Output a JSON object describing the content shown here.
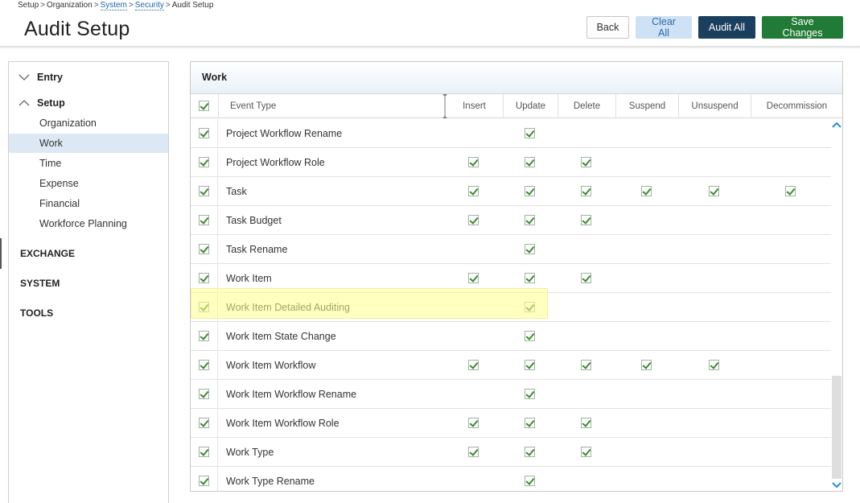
{
  "breadcrumb": {
    "items": [
      "Setup",
      "Organization",
      "System",
      "Security",
      "Audit Setup"
    ]
  },
  "page": {
    "title": "Audit Setup"
  },
  "toolbar": {
    "back_label": "Back",
    "clear_all_label": "Clear All",
    "audit_all_label": "Audit All",
    "save_label": "Save Changes"
  },
  "sidebar": {
    "groups": [
      {
        "label": "Entry",
        "expanded": false
      },
      {
        "label": "Setup",
        "expanded": true
      }
    ],
    "items": [
      "Organization",
      "Work",
      "Time",
      "Expense",
      "Financial",
      "Workforce Planning"
    ],
    "active_item": "Work",
    "sections": [
      "EXCHANGE",
      "SYSTEM",
      "TOOLS"
    ]
  },
  "panel": {
    "title": "Work",
    "columns": [
      "Event Type",
      "Insert",
      "Update",
      "Delete",
      "Suspend",
      "Unsuspend",
      "Decommission"
    ],
    "rows": [
      {
        "name": "Project Workflow Rename",
        "checks": [
          false,
          true,
          false,
          false,
          false,
          false
        ]
      },
      {
        "name": "Project Workflow Role",
        "checks": [
          true,
          true,
          true,
          false,
          false,
          false
        ]
      },
      {
        "name": "Task",
        "checks": [
          true,
          true,
          true,
          true,
          true,
          true
        ]
      },
      {
        "name": "Task Budget",
        "checks": [
          true,
          true,
          true,
          false,
          false,
          false
        ]
      },
      {
        "name": "Task Rename",
        "checks": [
          false,
          true,
          false,
          false,
          false,
          false
        ]
      },
      {
        "name": "Work Item",
        "checks": [
          true,
          true,
          true,
          false,
          false,
          false
        ]
      },
      {
        "name": "Work Item Detailed Auditing",
        "checks": [
          false,
          true,
          false,
          false,
          false,
          false
        ]
      },
      {
        "name": "Work Item State Change",
        "checks": [
          false,
          true,
          false,
          false,
          false,
          false
        ]
      },
      {
        "name": "Work Item Workflow",
        "checks": [
          true,
          true,
          true,
          true,
          true,
          false
        ]
      },
      {
        "name": "Work Item Workflow Rename",
        "checks": [
          false,
          true,
          false,
          false,
          false,
          false
        ]
      },
      {
        "name": "Work Item Workflow Role",
        "checks": [
          true,
          true,
          true,
          false,
          false,
          false
        ]
      },
      {
        "name": "Work Type",
        "checks": [
          true,
          true,
          true,
          false,
          false,
          false
        ]
      },
      {
        "name": "Work Type Rename",
        "checks": [
          false,
          true,
          false,
          false,
          false,
          false
        ]
      }
    ],
    "highlighted_row": "Work Item Detailed Auditing"
  },
  "colors": {
    "accent": "#1f63a8",
    "audit_all": "#1b3f5e",
    "save": "#217a35",
    "clear_all_bg": "#cfe2f5",
    "highlight": "#ffff8c",
    "check": "#3d8a2f"
  }
}
